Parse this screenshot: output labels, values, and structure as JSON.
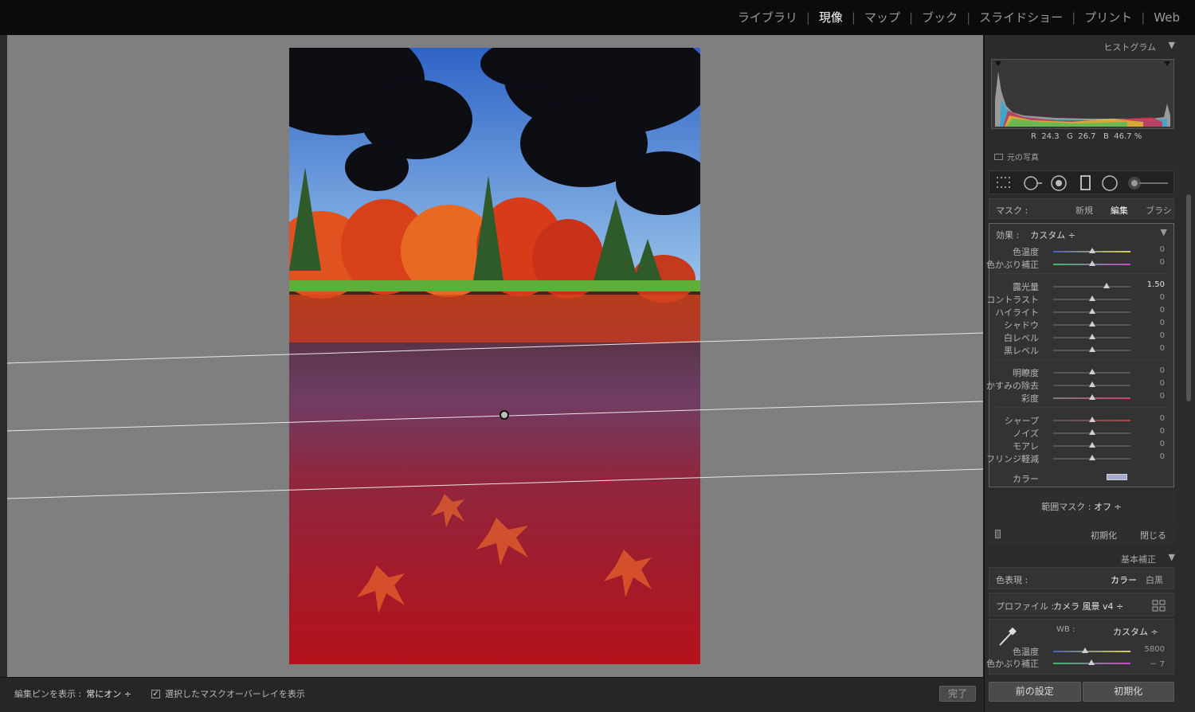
{
  "modules": [
    {
      "label": "ライブラリ",
      "active": false
    },
    {
      "label": "現像",
      "active": true
    },
    {
      "label": "マップ",
      "active": false
    },
    {
      "label": "ブック",
      "active": false
    },
    {
      "label": "スライドショー",
      "active": false
    },
    {
      "label": "プリント",
      "active": false
    },
    {
      "label": "Web",
      "active": false
    }
  ],
  "histogram": {
    "title": "ヒストグラム",
    "r_label": "R",
    "r_value": "24.3",
    "g_label": "G",
    "g_value": "26.7",
    "b_label": "B",
    "b_value": "46.7",
    "unit": "%",
    "original_photo_label": "元の写真"
  },
  "tool_icons": [
    "crop-overlay-icon",
    "spot-removal-icon",
    "red-eye-icon",
    "graduated-filter-icon",
    "radial-filter-icon",
    "adjustment-brush-icon"
  ],
  "mask": {
    "label": "マスク :",
    "options": [
      {
        "label": "新規",
        "active": false
      },
      {
        "label": "編集",
        "active": true
      },
      {
        "label": "ブラシ",
        "active": false
      }
    ]
  },
  "effects": {
    "label": "効果 :",
    "preset": "カスタム ÷",
    "groups": [
      [
        {
          "name": "色温度",
          "value": "0",
          "level": 0.5,
          "gradient": [
            "#4a5fb6",
            "#d9d24a"
          ]
        },
        {
          "name": "色かぶり補正",
          "value": "0",
          "level": 0.5,
          "gradient": [
            "#3fb86b",
            "#c44ac0"
          ]
        }
      ],
      [
        {
          "name": "露光量",
          "value": "1.50",
          "level": 0.69,
          "bright": true
        },
        {
          "name": "コントラスト",
          "value": "0",
          "level": 0.5
        },
        {
          "name": "ハイライト",
          "value": "0",
          "level": 0.5
        },
        {
          "name": "シャドウ",
          "value": "0",
          "level": 0.5
        },
        {
          "name": "白レベル",
          "value": "0",
          "level": 0.5
        },
        {
          "name": "黒レベル",
          "value": "0",
          "level": 0.5
        }
      ],
      [
        {
          "name": "明瞭度",
          "value": "0",
          "level": 0.5
        },
        {
          "name": "かすみの除去",
          "value": "0",
          "level": 0.5
        },
        {
          "name": "彩度",
          "value": "0",
          "level": 0.5,
          "gradient": [
            "#7a7a7a",
            "#d0426a"
          ]
        }
      ],
      [
        {
          "name": "シャープ",
          "value": "0",
          "level": 0.5,
          "gradient": [
            "#555555",
            "#b4464a"
          ]
        },
        {
          "name": "ノイズ",
          "value": "0",
          "level": 0.5
        },
        {
          "name": "モアレ",
          "value": "0",
          "level": 0.5
        },
        {
          "name": "フリンジ軽減",
          "value": "0",
          "level": 0.5
        }
      ]
    ],
    "color_label": "カラー",
    "color_swatch": "#a3a9cf"
  },
  "range_mask": {
    "label": "範囲マスク :",
    "value": "オフ ÷"
  },
  "reset_label": "初期化",
  "close_label": "閉じる",
  "basic": {
    "title": "基本補正",
    "treatment_label": "色表現 :",
    "treatment_options": [
      {
        "label": "カラー",
        "active": true
      },
      {
        "label": "白黒",
        "active": false
      }
    ],
    "profile_label": "プロファイル :",
    "profile_value": "カメラ 風景 v4 ÷",
    "wb_label": "WB :",
    "wb_value": "カスタム ÷",
    "sliders": [
      {
        "name": "色温度",
        "value": "5800",
        "level": 0.41,
        "gradient": [
          "#4a5fb6",
          "#d9d24a"
        ]
      },
      {
        "name": "色かぶり補正",
        "value": "－ 7",
        "level": 0.49,
        "gradient": [
          "#3fb86b",
          "#c44ac0"
        ]
      }
    ]
  },
  "buttons": {
    "previous": "前の設定",
    "reset": "初期化"
  },
  "toolbar": {
    "pin_label": "編集ピンを表示 :",
    "pin_value": "常にオン ÷",
    "overlay_checked": true,
    "overlay_label": "選択したマスクオーバーレイを表示",
    "done_label": "完了"
  },
  "overlay_color": "#b5121b"
}
